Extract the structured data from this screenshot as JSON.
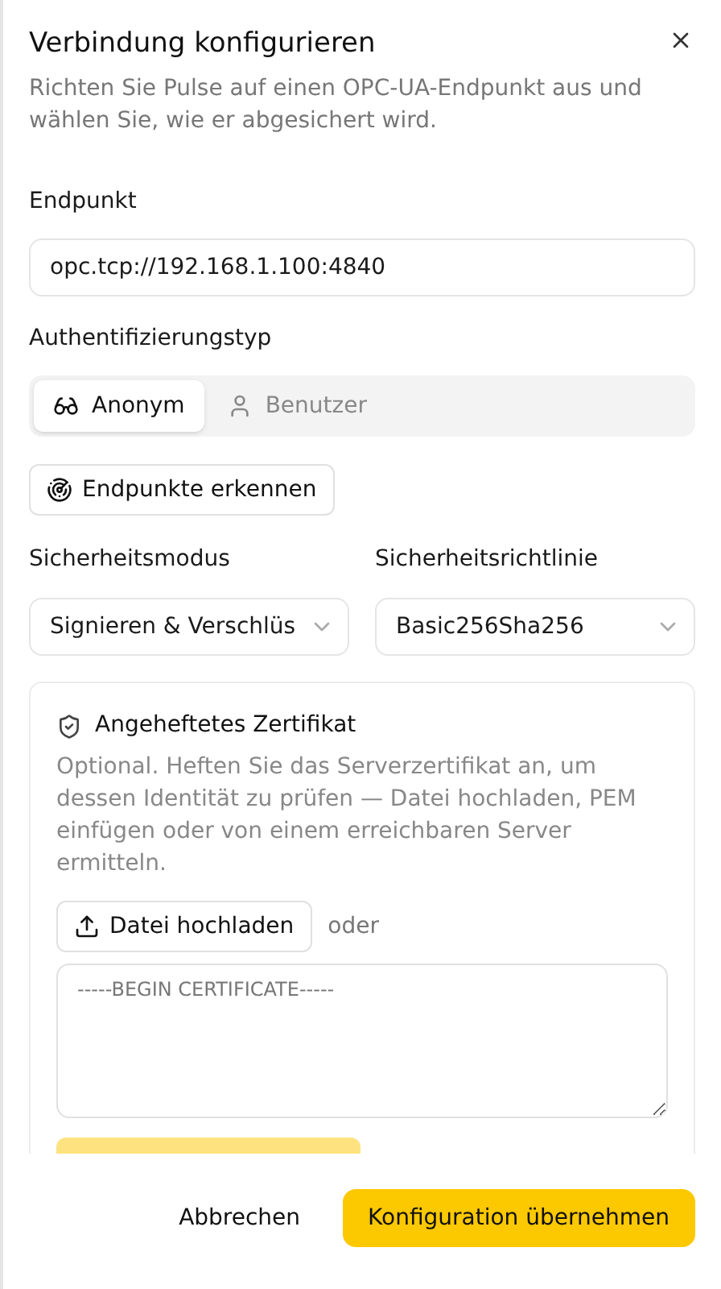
{
  "dialog": {
    "title": "Verbindung konfigurieren",
    "description": "Richten Sie Pulse auf einen OPC-UA-Endpunkt aus und wählen Sie, wie er abgesichert wird."
  },
  "endpoint": {
    "label": "Endpunkt",
    "value": "opc.tcp://192.168.1.100:4840"
  },
  "auth": {
    "label": "Authentifizierungstyp",
    "options": [
      {
        "label": "Anonym",
        "kind": "anonymous",
        "selected": true
      },
      {
        "label": "Benutzer",
        "kind": "user",
        "selected": false
      }
    ]
  },
  "discover_button": "Endpunkte erkennen",
  "security_mode": {
    "label": "Sicherheitsmodus",
    "value": "Signieren & Verschlüs"
  },
  "security_policy": {
    "label": "Sicherheitsrichtlinie",
    "value": "Basic256Sha256"
  },
  "certificate": {
    "title": "Angeheftetes Zertifikat",
    "description": "Optional. Heften Sie das Serverzertifikat an, um dessen Identität zu prüfen — Datei hochladen, PEM einfügen oder von einem erreichbaren Server ermitteln.",
    "upload_button": "Datei hochladen",
    "or_text": "oder",
    "pem_placeholder": "-----BEGIN CERTIFICATE-----",
    "fetch_button": {
      "disabled": true
    }
  },
  "footer": {
    "cancel": "Abbrechen",
    "confirm": "Konfiguration übernehmen"
  }
}
